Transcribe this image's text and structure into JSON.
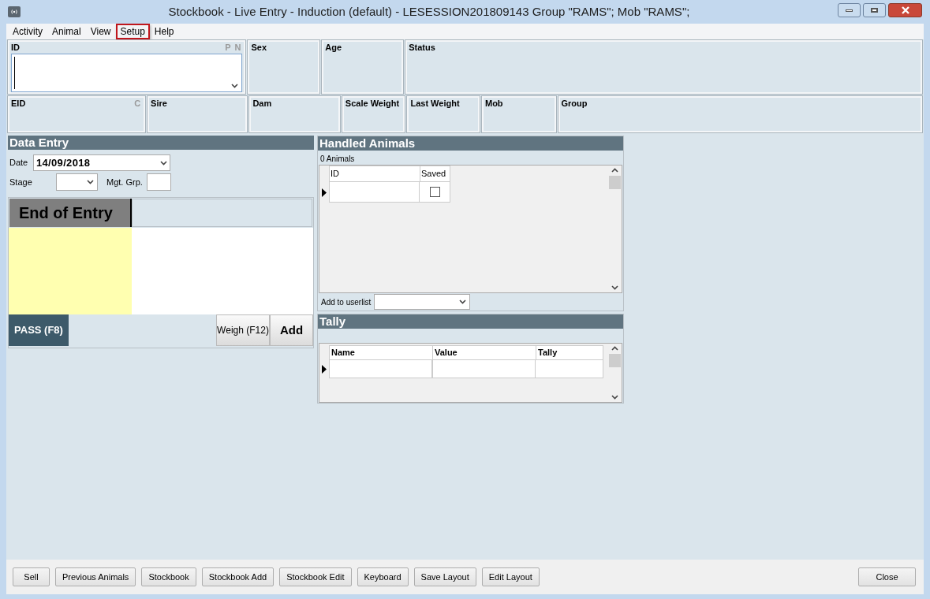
{
  "window": {
    "title": "Stockbook - Live Entry - Induction (default) - LESESSION201809143 Group \"RAMS\"; Mob \"RAMS\";"
  },
  "menu": [
    {
      "label": "Activity",
      "selected": false
    },
    {
      "label": "Animal",
      "selected": false
    },
    {
      "label": "View",
      "selected": false
    },
    {
      "label": "Setup",
      "selected": true
    },
    {
      "label": "Help",
      "selected": false
    }
  ],
  "id_field": {
    "label": "ID",
    "flags": [
      "P",
      "N"
    ]
  },
  "top_fields": [
    {
      "label": "Sex"
    },
    {
      "label": "Age"
    },
    {
      "label": "Status"
    }
  ],
  "eid_field": {
    "label": "EID",
    "flags": [
      "C"
    ]
  },
  "second_fields": [
    {
      "label": "Sire"
    },
    {
      "label": "Dam"
    },
    {
      "label": "Scale Weight"
    },
    {
      "label": "Last Weight"
    },
    {
      "label": "Mob"
    },
    {
      "label": "Group"
    }
  ],
  "data_entry": {
    "title": "Data Entry",
    "date_label": "Date",
    "date_value": "14/09/2018",
    "stage_label": "Stage",
    "mgt_label": "Mgt. Grp.",
    "entry_title": "End of Entry",
    "pass_button": "PASS (F8)",
    "weigh_button": "Weigh (F12)",
    "add_button": "Add"
  },
  "handled": {
    "title": "Handled Animals",
    "count": "0 Animals",
    "columns": [
      "ID",
      "Saved"
    ],
    "rows": [
      {
        "saved": false
      }
    ],
    "userlist_label": "Add to userlist"
  },
  "tally": {
    "title": "Tally",
    "columns": [
      "Name",
      "Value",
      "Tally"
    ]
  },
  "bottom_buttons": [
    "Sell",
    "Previous Animals",
    "Stockbook",
    "Stockbook Add",
    "Stockbook Edit",
    "Keyboard",
    "Save Layout",
    "Edit Layout"
  ],
  "close_button": "Close"
}
